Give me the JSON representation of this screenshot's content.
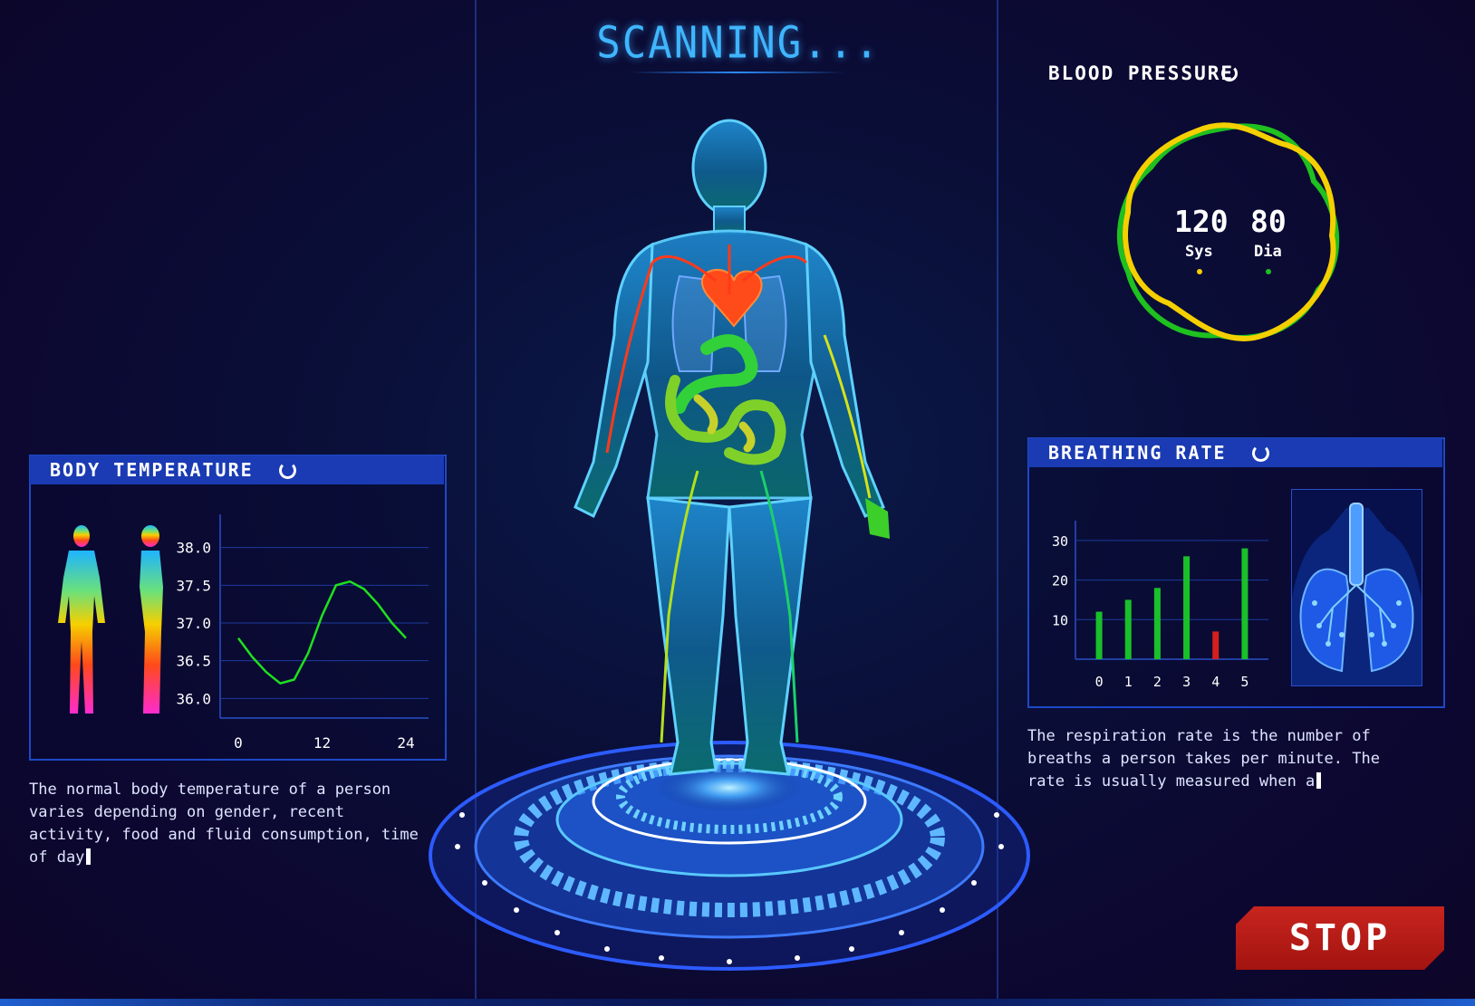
{
  "header": {
    "title": "SCANNING..."
  },
  "body_temperature": {
    "title": "BODY TEMPERATURE",
    "status_icon": "loading-spinner-icon",
    "description": "The normal body temperature of a person\nvaries depending on gender, recent\nactivity, food and fluid consumption, time\nof day",
    "figures_icon": "thermal-body-figures-icon",
    "chart_data": {
      "type": "line",
      "x": [
        0,
        2,
        4,
        6,
        8,
        10,
        12,
        14,
        16,
        18,
        20,
        22,
        24
      ],
      "y": [
        36.8,
        36.55,
        36.35,
        36.2,
        36.25,
        36.6,
        37.1,
        37.5,
        37.55,
        37.45,
        37.25,
        37.0,
        36.8
      ],
      "x_ticks": [
        "0",
        "12",
        "24"
      ],
      "y_ticks": [
        "38.0",
        "37.5",
        "37.0",
        "36.5",
        "36.0"
      ],
      "ylim": [
        35.8,
        38.2
      ],
      "xlim": [
        0,
        24
      ],
      "grid": true,
      "line_color": "#1fe01f"
    }
  },
  "blood_pressure": {
    "title": "BLOOD PRESSURE",
    "status_icon": "loading-spinner-icon",
    "systolic": {
      "value": "120",
      "label": "Sys",
      "color": "#f5d000"
    },
    "diastolic": {
      "value": "80",
      "label": "Dia",
      "color": "#1fc01f"
    }
  },
  "breathing_rate": {
    "title": "BREATHING RATE",
    "status_icon": "loading-spinner-icon",
    "lungs_icon": "lungs-icon",
    "description": "The respiration rate is the number of\nbreaths a person takes per minute. The\nrate is usually measured when a",
    "chart_data": {
      "type": "bar",
      "categories": [
        "0",
        "1",
        "2",
        "3",
        "4",
        "5"
      ],
      "values": [
        12,
        15,
        18,
        26,
        7,
        28
      ],
      "colors": [
        "#19c02a",
        "#19c02a",
        "#19c02a",
        "#19c02a",
        "#d4201c",
        "#19c02a"
      ],
      "y_ticks": [
        "10",
        "20",
        "30"
      ],
      "ylim": [
        0,
        35
      ],
      "grid": true
    }
  },
  "body_scan": {
    "figure_icon": "human-anatomy-body-icon",
    "platform_icon": "holographic-scan-platform-icon"
  },
  "stop_button": {
    "label": "STOP",
    "color": "#c41f1a"
  }
}
